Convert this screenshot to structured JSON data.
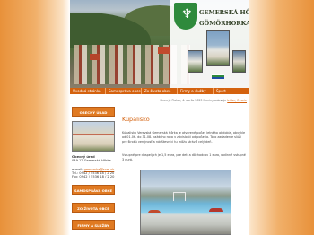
{
  "header": {
    "town_name_1": "GEMERSKÁ HÔRKA",
    "town_name_2": "GÖMÖRHORKA"
  },
  "nav": {
    "items": [
      {
        "label": "Úvodná stránka"
      },
      {
        "label": "Samospráva obce"
      },
      {
        "label": "Zo života obce"
      },
      {
        "label": "Firmy a služby"
      },
      {
        "label": "Šport"
      }
    ]
  },
  "dateline": {
    "text": "Dnes je Piatok, 4. apríla 2023 Meniny oslavuje ",
    "link": "Izidor, Ovocie"
  },
  "sidebar": {
    "top_button": "OBECNÝ ÚRAD",
    "office_title": "Obecný úrad",
    "address": "049 12 Gemerská Hôrka",
    "email_label": "e-mail: ",
    "email": "gemerska@szm.sk",
    "phone": "Tel.: 0942 / 5536 18 / 2 20",
    "fax": "Fax: 0942 / 5536 18 / 2 20",
    "buttons": [
      {
        "label": "SAMOSPRÁVA OBCE"
      },
      {
        "label": "ZO ŽIVOTA OBCE"
      },
      {
        "label": "FIRMY A SLUŽBY"
      }
    ]
  },
  "main": {
    "title": "Kúpalisko",
    "para1": "Kúpalisko Verevská Gemerská Hôrka je otvorené počas letného obdobia, obvykle od 01.06. do 31.08. každého roka v závislosti od počasia. Toto zariadenie slúži pre širokú verejnosť a návštevníci tu môžu stráviť celý deň.",
    "para2": "Vstupné pre dospelých je 1,5 eura, pre deti a dôchodcov 1 euro, rodinné vstupné 3 eurá."
  },
  "colors": {
    "accent": "#d4620f",
    "crest_green": "#2f8a3c"
  }
}
